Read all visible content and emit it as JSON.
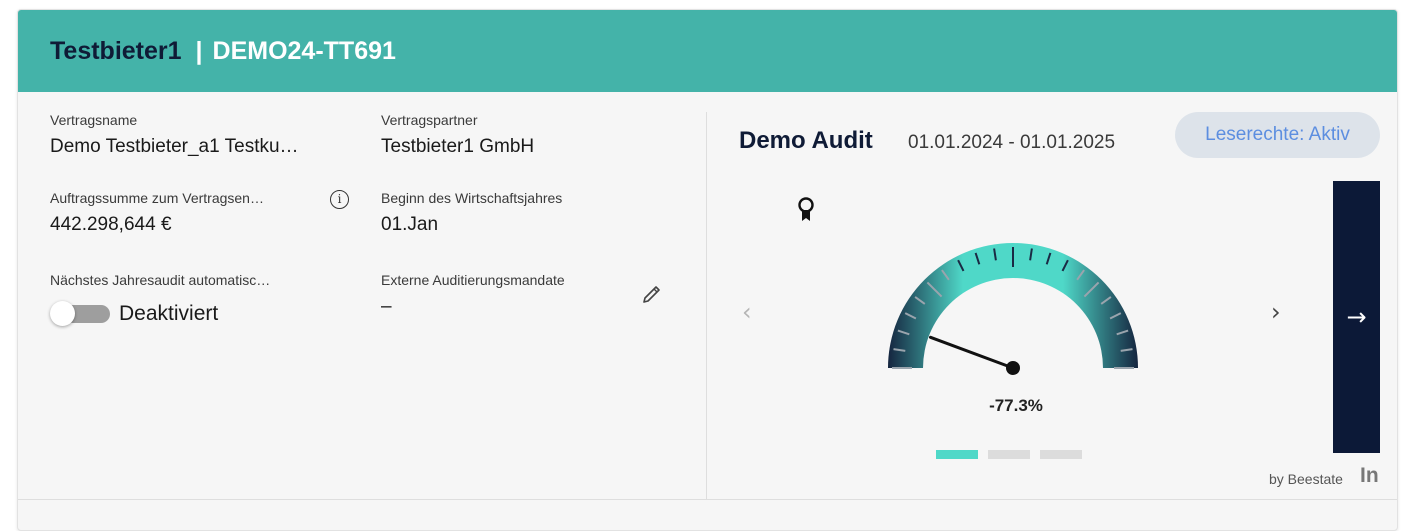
{
  "header": {
    "company": "Testbieter1",
    "separator": "|",
    "contract_code": "DEMO24-TT691"
  },
  "fields": [
    {
      "label": "Vertragsname",
      "value": "Demo Testbieter_a1 Testku…"
    },
    {
      "label": "Vertragspartner",
      "value": "Testbieter1 GmbH"
    },
    {
      "label": "Auftragssumme zum Vertragsen…",
      "value": "442.298,644 €"
    },
    {
      "label": "Beginn des Wirtschaftsjahres",
      "value": "01.Jan"
    },
    {
      "label": "Nächstes Jahresaudit automatisc…",
      "value": ""
    },
    {
      "label": "Externe Auditierungsmandate",
      "value": "–"
    }
  ],
  "info_icon": {
    "glyph": "i",
    "icon": "info-icon"
  },
  "toggle": {
    "label": "Deaktiviert",
    "state": "off"
  },
  "edit_icon": {
    "icon": "pencil-icon"
  },
  "audit": {
    "title": "Demo Audit",
    "dates": "01.01.2024 - 01.01.2025",
    "badge": "Leserechte: Aktiv",
    "gauge_value": "-77.3%",
    "gauge_percent": -77.3,
    "prev": "‹",
    "next": "›",
    "go": "→",
    "pager": {
      "count": 3,
      "active": 0
    }
  },
  "footer": {
    "by": "by Beestate",
    "logo": "In"
  },
  "colors": {
    "header_bg": "#44b3a9",
    "header_title": "#0f1b36",
    "badge_text": "#5c8ee0",
    "gauge_dark": "#15253f",
    "gauge_light": "#4fd8c8",
    "go_panel": "#0c1937"
  }
}
